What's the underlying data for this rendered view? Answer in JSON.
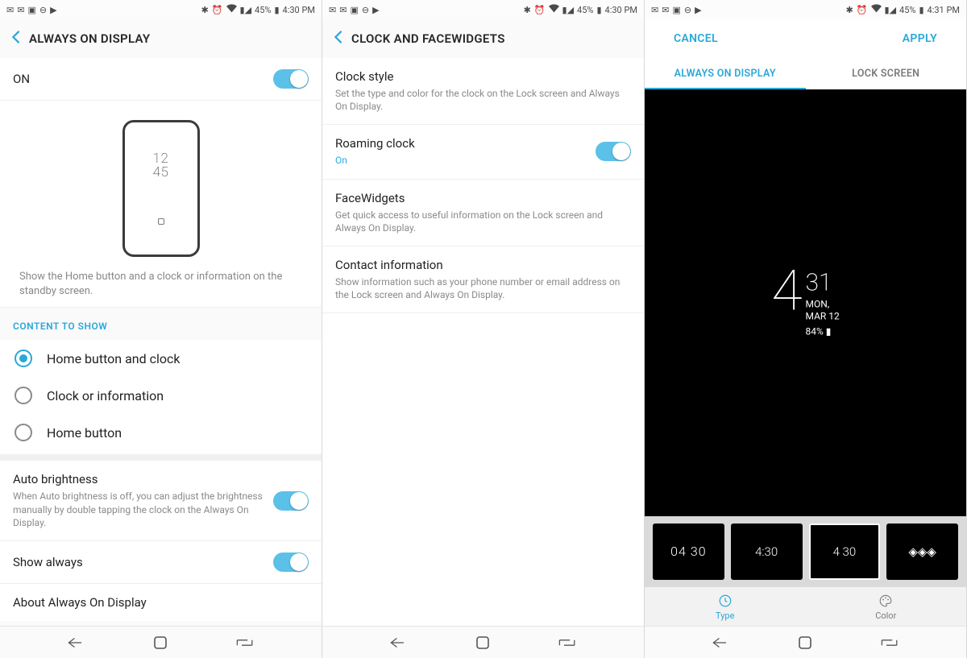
{
  "accent": "#2aa8d8",
  "panels": {
    "s1": {
      "status": {
        "time": "4:30 PM",
        "batt": "45%"
      },
      "title": "ALWAYS ON DISPLAY",
      "on_row": {
        "label": "ON",
        "value": true
      },
      "preview": {
        "clock_top": "12",
        "clock_bottom": "45",
        "caption": "Show the Home button and a clock or information on the standby screen."
      },
      "section": "CONTENT TO SHOW",
      "radios": [
        {
          "label": "Home button and clock",
          "selected": true
        },
        {
          "label": "Clock or information",
          "selected": false
        },
        {
          "label": "Home button",
          "selected": false
        }
      ],
      "auto_brightness": {
        "title": "Auto brightness",
        "sub": "When Auto brightness is off, you can adjust the brightness manually by double tapping the clock on the Always On Display.",
        "value": true
      },
      "show_always": {
        "title": "Show always",
        "value": true
      },
      "about": {
        "title": "About Always On Display"
      }
    },
    "s2": {
      "status": {
        "time": "4:30 PM",
        "batt": "45%"
      },
      "title": "CLOCK AND FACEWIDGETS",
      "items": [
        {
          "title": "Clock style",
          "sub": "Set the type and color for the clock on the Lock screen and Always On Display.",
          "toggle": null
        },
        {
          "title": "Roaming clock",
          "sub": "On",
          "sub_is_on": true,
          "toggle": true
        },
        {
          "title": "FaceWidgets",
          "sub": "Get quick access to useful information on the Lock screen and Always On Display.",
          "toggle": null
        },
        {
          "title": "Contact information",
          "sub": "Show information such as your phone number or email address on the Lock screen and Always On Display.",
          "toggle": null
        }
      ]
    },
    "s3": {
      "status": {
        "time": "4:31 PM",
        "batt": "45%"
      },
      "cancel": "CANCEL",
      "apply": "APPLY",
      "tabs": {
        "active": "ALWAYS ON DISPLAY",
        "other": "LOCK SCREEN"
      },
      "clock": {
        "hour": "4",
        "minute": "31",
        "date_l1": "MON,",
        "date_l2": "MAR 12",
        "batt": "84%"
      },
      "bottom_tabs": {
        "type": "Type",
        "color": "Color"
      },
      "style_selected_index": 2,
      "style_samples": [
        "04\n30",
        "4:30",
        "4 30",
        "◈◈◈"
      ]
    }
  }
}
